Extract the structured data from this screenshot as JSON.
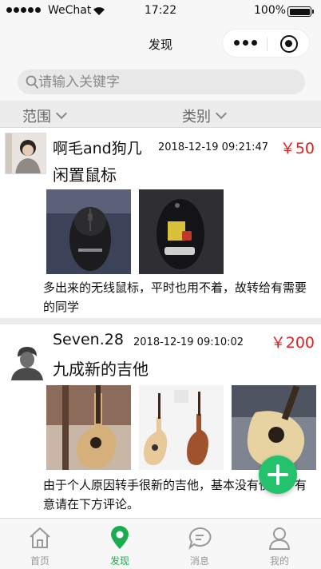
{
  "status_bar": {
    "carrier": "WeChat",
    "time": "17:22",
    "battery": "100%",
    "battery_level": 1.0
  },
  "nav": {
    "title": "发现"
  },
  "search": {
    "placeholder": "请输入关键字",
    "value": ""
  },
  "filters": {
    "scope_label": "范围",
    "category_label": "类别"
  },
  "posts": [
    {
      "user": "啊毛and狗几",
      "time": "2018-12-19 09:21:47",
      "price": "￥50",
      "title": "闲置鼠标",
      "description": "多出来的无线鼠标，平时也用不着，故转给有需要的同学",
      "photo_count": 2
    },
    {
      "user": "Seven.28",
      "time": "2018-12-19 09:10:02",
      "price": "￥200",
      "title": "九成新的吉他",
      "description": "由于个人原因转手很新的吉他，基本没有使用，有意请在下方评论。",
      "photo_count": 3
    }
  ],
  "tab_bar": {
    "items": [
      {
        "label": "首页",
        "icon": "home-icon",
        "active": false
      },
      {
        "label": "发现",
        "icon": "location-pin-icon",
        "active": true
      },
      {
        "label": "消息",
        "icon": "chat-bubble-icon",
        "active": false
      },
      {
        "label": "我的",
        "icon": "person-icon",
        "active": false
      }
    ]
  },
  "colors": {
    "accent": "#1aad4f",
    "fab": "#24c26c",
    "price": "#e02020",
    "inactive": "#999999"
  }
}
